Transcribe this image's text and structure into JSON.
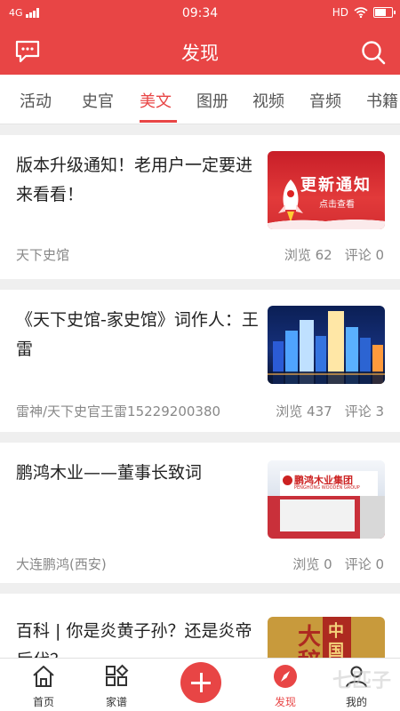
{
  "status_bar": {
    "network": "4G",
    "time": "09:34",
    "hd": "HD"
  },
  "header": {
    "title": "发现",
    "left_icon": "message-icon",
    "right_icon": "search-icon"
  },
  "tabs": [
    {
      "label": "活动"
    },
    {
      "label": "史官"
    },
    {
      "label": "美文",
      "active": true
    },
    {
      "label": "图册"
    },
    {
      "label": "视频"
    },
    {
      "label": "音频"
    },
    {
      "label": "书籍"
    }
  ],
  "articles": [
    {
      "title": "版本升级通知！老用户一定要进来看看！",
      "source": "天下史馆",
      "views_label": "浏览 62",
      "comments_label": "评论 0",
      "thumb": {
        "headline": "更新通知",
        "sub": "点击查看"
      }
    },
    {
      "title": "《天下史馆-家史馆》词作人：王雷",
      "source": "雷神/天下史官王雷15229200380",
      "views_label": "浏览 437",
      "comments_label": "评论 3",
      "thumb": {
        "kind": "city-night-photo"
      }
    },
    {
      "title": "鹏鸿木业——董事长致词",
      "source": "大连鹏鸿(西安)",
      "views_label": "浏览 0",
      "comments_label": "评论 0",
      "thumb": {
        "sign": "鹏鸿木业集团",
        "sign_en": "PENGHONG WOODEN GROUP"
      }
    },
    {
      "title": "百科 | 你是炎黄子孙？还是炎帝后代？",
      "thumb": {
        "chars": [
          "中",
          "国",
          "大",
          "辞"
        ]
      }
    }
  ],
  "bottom_nav": [
    {
      "label": "首页",
      "icon": "home-icon"
    },
    {
      "label": "家谱",
      "icon": "grid-icon"
    },
    {
      "label": "",
      "icon": "plus-icon"
    },
    {
      "label": "发现",
      "icon": "compass-icon",
      "active": true
    },
    {
      "label": "我的",
      "icon": "user-icon"
    }
  ],
  "watermark": "七匹子",
  "colors": {
    "accent": "#e84545",
    "background": "#efefef",
    "muted_text": "#888888"
  }
}
